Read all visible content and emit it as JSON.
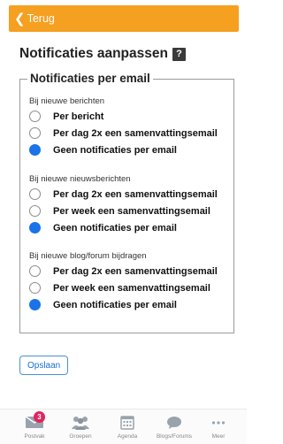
{
  "header": {
    "back_label": "Terug",
    "accent_color": "#f5a020"
  },
  "page": {
    "title": "Notificaties aanpassen",
    "help_icon": "?"
  },
  "fieldset": {
    "legend": "Notificaties per email",
    "groups": [
      {
        "title": "Bij nieuwe berichten",
        "options": [
          {
            "label": "Per bericht",
            "checked": false
          },
          {
            "label": "Per dag 2x een samenvattingsemail",
            "checked": false
          },
          {
            "label": "Geen notificaties per email",
            "checked": true
          }
        ]
      },
      {
        "title": "Bij nieuwe nieuwsberichten",
        "options": [
          {
            "label": "Per dag 2x een samenvattingsemail",
            "checked": false
          },
          {
            "label": "Per week een samenvattingsemail",
            "checked": false
          },
          {
            "label": "Geen notificaties per email",
            "checked": true
          }
        ]
      },
      {
        "title": "Bij nieuwe blog/forum bijdragen",
        "options": [
          {
            "label": "Per dag 2x een samenvattingsemail",
            "checked": false
          },
          {
            "label": "Per week een samenvattingsemail",
            "checked": false
          },
          {
            "label": "Geen notificaties per email",
            "checked": true
          }
        ]
      }
    ]
  },
  "save_label": "Opslaan",
  "tabbar": {
    "items": [
      {
        "label": "Postvak",
        "icon": "mail-icon",
        "badge": "3"
      },
      {
        "label": "Groepen",
        "icon": "people-icon"
      },
      {
        "label": "Agenda",
        "icon": "calendar-icon"
      },
      {
        "label": "Blogs/Forums",
        "icon": "chat-bubble-icon"
      },
      {
        "label": "Meer",
        "icon": "more-dots-icon"
      }
    ]
  }
}
